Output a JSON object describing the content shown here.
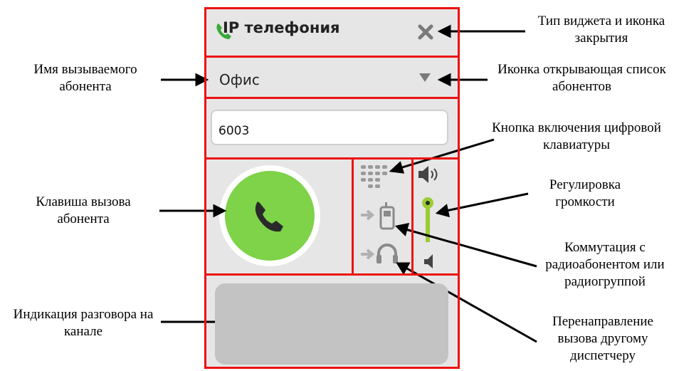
{
  "widget": {
    "title": "IP телефония",
    "subscriber": "Офис",
    "number_value": "6003"
  },
  "labels": {
    "widget_type": "Тип виджета и иконка закрытия",
    "subscriber_name": "Имя вызываемого абонента",
    "subscriber_list": "Иконка открывающая список абонентов",
    "keypad": "Кнопка включения цифровой клавиатуры",
    "call_key": "Клавиша вызова абонента",
    "volume": "Регулировка громкости",
    "radio_switch": "Коммутация с радиоабонентом или радиогруппой",
    "indication": "Индикация разговора на канале",
    "redirect": "Перенаправление вызова другому диспетчеру"
  },
  "colors": {
    "frame": "#ee1111",
    "call_button": "#7ed348",
    "slider": "#9acd32",
    "icon_gray": "#9a9a9a"
  },
  "icons": [
    "phone-icon",
    "close-icon",
    "dropdown-arrow-icon",
    "clear-icon",
    "keypad-icon",
    "speaker-loud-icon",
    "speaker-quiet-icon",
    "handset-forward-icon",
    "headset-forward-icon"
  ]
}
